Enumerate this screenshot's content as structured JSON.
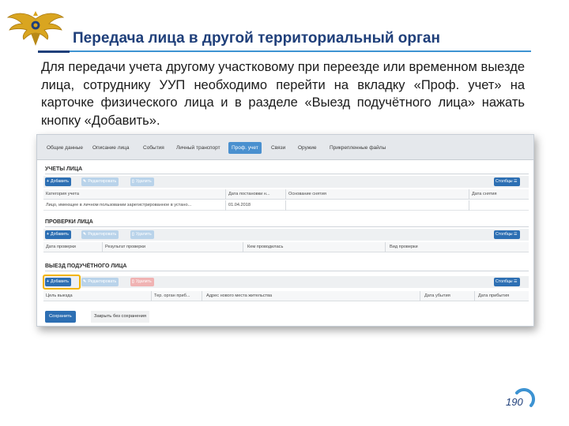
{
  "slide": {
    "title": "Передача лица в другой территориальный орган",
    "body": "Для передачи учета другому участковому при переезде или временном выезде лица, сотруднику УУП необходимо перейти на вкладку «Проф. учет» на карточке физического лица и в разделе «Выезд подучётного лица» нажать кнопку «Добавить».",
    "page_number": "190"
  },
  "screenshot": {
    "tabs": [
      {
        "label": "Общие данные",
        "active": false
      },
      {
        "label": "Описание лица",
        "active": false
      },
      {
        "label": "События",
        "active": false
      },
      {
        "label": "Личный транспорт",
        "active": false
      },
      {
        "label": "Проф. учет",
        "active": true
      },
      {
        "label": "Связи",
        "active": false
      },
      {
        "label": "Оружие",
        "active": false
      },
      {
        "label": "Прикрепленные файлы",
        "active": false
      }
    ],
    "buttons": {
      "add": "Добавить",
      "edit": "Редактировать",
      "delete": "Удалить",
      "columns": "Столбцы",
      "save": "Сохранить",
      "close": "Закрыть без сохранения"
    },
    "sections": {
      "accounts": {
        "title": "УЧЕТЫ ЛИЦА",
        "columns": [
          "Категория учета",
          "Дата постановки н...",
          "Основание снятия",
          "Дата снятия"
        ],
        "rows": [
          [
            "Лицо, имеющее в личном пользовании зарегистрированное в устано...",
            "01.04.2018",
            "",
            ""
          ]
        ]
      },
      "checks": {
        "title": "ПРОВЕРКИ ЛИЦА",
        "columns": [
          "Дата проверки",
          "Результат проверки",
          "Кем проводилась",
          "Вид проверки"
        ]
      },
      "departure": {
        "title": "ВЫЕЗД ПОДУЧЁТНОГО ЛИЦА",
        "columns": [
          "Цель выезда",
          "Тер. орган приб...",
          "Адрес нового места жительства",
          "Дата убытия",
          "Дата прибытия"
        ]
      }
    }
  },
  "colors": {
    "title": "#1f3f7a",
    "accent": "#3d93d2",
    "primary_button": "#2d6fb3",
    "highlight": "#f2b400"
  }
}
